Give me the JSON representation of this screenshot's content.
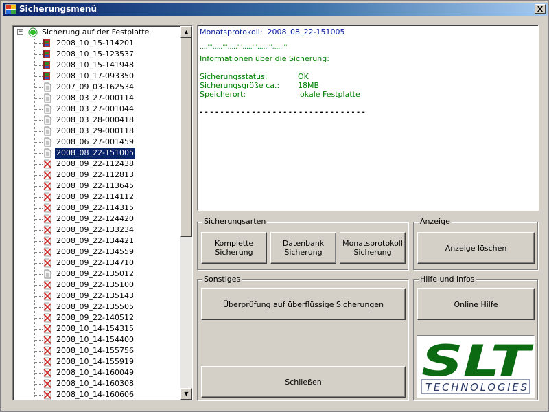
{
  "window": {
    "title": "Sicherungsmenü",
    "close_label": "X"
  },
  "tree": {
    "root_label": "Sicherung auf der Festplatte",
    "root_expander": "−",
    "items": [
      {
        "label": "2008_10_15-114201",
        "icon": "archive-icon"
      },
      {
        "label": "2008_10_15-123537",
        "icon": "archive-icon"
      },
      {
        "label": "2008_10_15-141948",
        "icon": "archive-icon"
      },
      {
        "label": "2008_10_17-093350",
        "icon": "archive-icon"
      },
      {
        "label": "2007_09_03-162534",
        "icon": "document-icon"
      },
      {
        "label": "2008_03_27-000114",
        "icon": "document-icon"
      },
      {
        "label": "2008_03_27-001044",
        "icon": "document-icon"
      },
      {
        "label": "2008_03_28-000418",
        "icon": "document-icon"
      },
      {
        "label": "2008_03_29-000118",
        "icon": "document-icon"
      },
      {
        "label": "2008_06_27-001459",
        "icon": "document-icon"
      },
      {
        "label": "2008_08_22-151005",
        "icon": "document-icon",
        "selected": true
      },
      {
        "label": "2008_09_22-112438",
        "icon": "error-icon"
      },
      {
        "label": "2008_09_22-112813",
        "icon": "error-icon"
      },
      {
        "label": "2008_09_22-113645",
        "icon": "error-icon"
      },
      {
        "label": "2008_09_22-114112",
        "icon": "error-icon"
      },
      {
        "label": "2008_09_22-114315",
        "icon": "error-icon"
      },
      {
        "label": "2008_09_22-124420",
        "icon": "error-icon"
      },
      {
        "label": "2008_09_22-133234",
        "icon": "error-icon"
      },
      {
        "label": "2008_09_22-134421",
        "icon": "error-icon"
      },
      {
        "label": "2008_09_22-134559",
        "icon": "error-icon"
      },
      {
        "label": "2008_09_22-134710",
        "icon": "error-icon"
      },
      {
        "label": "2008_09_22-135012",
        "icon": "document-icon"
      },
      {
        "label": "2008_09_22-135100",
        "icon": "error-icon"
      },
      {
        "label": "2008_09_22-135143",
        "icon": "error-icon"
      },
      {
        "label": "2008_09_22-135505",
        "icon": "error-icon"
      },
      {
        "label": "2008_09_22-140512",
        "icon": "error-icon"
      },
      {
        "label": "2008_10_14-154315",
        "icon": "error-icon"
      },
      {
        "label": "2008_10_14-154400",
        "icon": "error-icon"
      },
      {
        "label": "2008_10_14-155756",
        "icon": "error-icon"
      },
      {
        "label": "2008_10_14-155919",
        "icon": "error-icon"
      },
      {
        "label": "2008_10_14-160049",
        "icon": "error-icon"
      },
      {
        "label": "2008_10_14-160308",
        "icon": "error-icon"
      },
      {
        "label": "2008_10_14-160606",
        "icon": "error-icon"
      }
    ],
    "scroll_up": "▲",
    "scroll_down": "▼"
  },
  "log": {
    "header_label": "Monatsprotokoll:",
    "header_value": "2008_08_22-151005",
    "dots_line": "....'''.....'''.....'''.....'''.....'''.....'''",
    "info_heading": "Informationen über die Sicherung:",
    "rows": [
      {
        "label": "Sicherungsstatus:",
        "value": "OK"
      },
      {
        "label": "Sicherungsgröße ca.:",
        "value": "18MB"
      },
      {
        "label": "Speicherort:",
        "value": "lokale Festplatte"
      }
    ],
    "separator": "- - - - - - - - - - - - - - - - - - - - - - - - - - - - - - - -"
  },
  "groups": {
    "sicherungsarten": {
      "title": "Sicherungsarten",
      "buttons": [
        "Komplette\nSicherung",
        "Datenbank\nSicherung",
        "Monatsprotokoll\nSicherung"
      ]
    },
    "anzeige": {
      "title": "Anzeige",
      "button": "Anzeige löschen"
    },
    "sonstiges": {
      "title": "Sonstiges",
      "check_button": "Überprüfung auf überflüssige Sicherungen",
      "close_button": "Schließen"
    },
    "hilfe": {
      "title": "Hilfe und Infos",
      "button": "Online Hilfe"
    }
  },
  "logo": {
    "main": "SLT",
    "sub": "TECHNOLOGIES",
    "color_green": "#0b6a12",
    "color_navy": "#2b3a66"
  },
  "colors": {
    "selection": "#0a246a",
    "log_blue": "#0a1fa0",
    "log_green": "#008000"
  }
}
